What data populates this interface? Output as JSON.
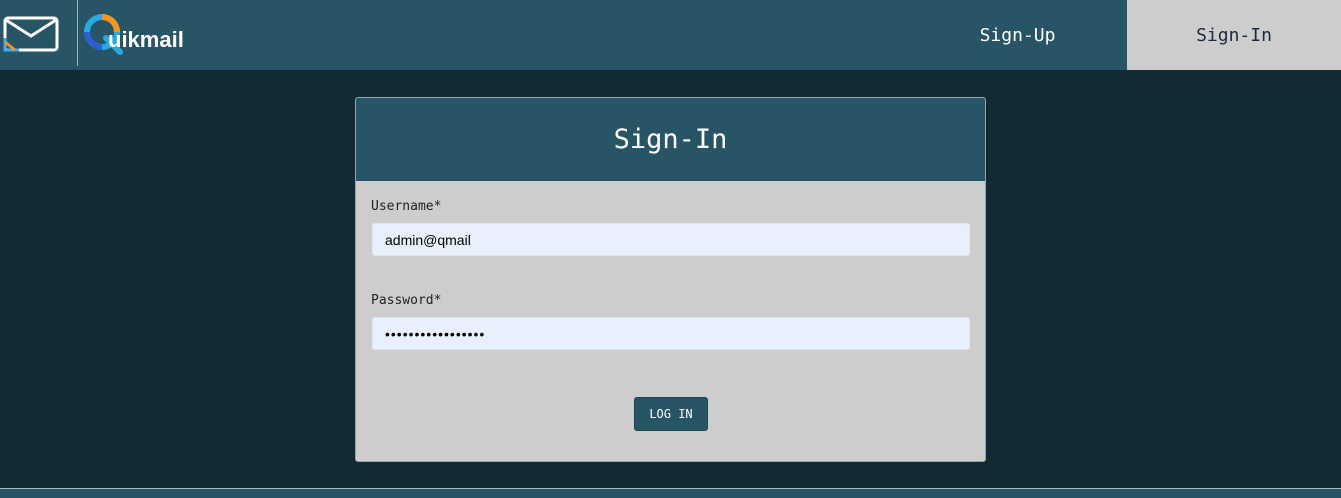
{
  "header": {
    "brand_name": "uikmail",
    "brand_logo_text": "Quikmail",
    "nav": {
      "signup_label": "Sign-Up",
      "signin_label": "Sign-In"
    }
  },
  "form": {
    "title": "Sign-In",
    "username_label": "Username*",
    "username_value": "admin@qmail",
    "password_label": "Password*",
    "password_value": "•••••••••••••••••",
    "submit_label": "LOG IN"
  },
  "icons": {
    "mail": "envelope-icon",
    "brand": "quikmail-logo"
  },
  "colors": {
    "background": "#132a32",
    "header": "#275565",
    "active_tab": "#cdcdcd",
    "card_body": "#cdcdcd",
    "input_bg": "#e8f0fe"
  }
}
